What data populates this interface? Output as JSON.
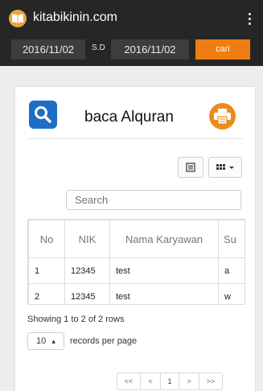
{
  "app": {
    "title": "kitabikinin.com"
  },
  "filter": {
    "date_from": "2016/11/02",
    "separator": "S.D",
    "date_to": "2016/11/02",
    "search_button": "cari"
  },
  "card": {
    "title": "baca Alquran"
  },
  "table": {
    "search_placeholder": "Search",
    "columns": [
      "No",
      "NIK",
      "Nama Karyawan",
      "Su"
    ],
    "rows": [
      [
        "1",
        "12345",
        "test",
        "a"
      ],
      [
        "2",
        "12345",
        "test",
        "w"
      ]
    ]
  },
  "footer": {
    "status": "Showing 1 to 2 of 2 rows",
    "page_size": "10",
    "page_size_caret": "▴",
    "records_label": "records per page"
  },
  "pagination": {
    "first": "<<",
    "prev": "<",
    "current": "1",
    "next": ">",
    "last": ">>"
  },
  "colors": {
    "accent_orange": "#f07d12",
    "search_blue": "#1e6fc4",
    "topbar": "#262626"
  }
}
